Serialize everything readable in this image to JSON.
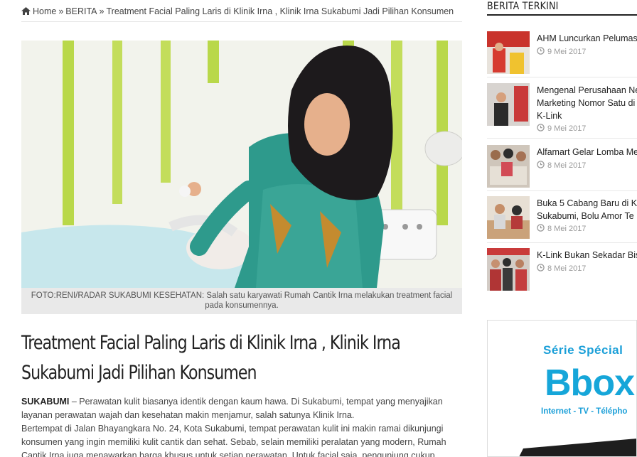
{
  "breadcrumb": {
    "home": "Home",
    "sep": "»",
    "section": "BERITA",
    "current": "Treatment Facial Paling Laris di Klinik Irna , Klinik Irna Sukabumi Jadi Pilihan Konsumen"
  },
  "article": {
    "photo_caption": "FOTO:RENI/RADAR SUKABUMI KESEHATAN: Salah satu karyawati Rumah Cantik Irna melakukan treatment facial pada konsumennya.",
    "title": "Treatment Facial Paling Laris di Klinik Irna , Klinik Irna Sukabumi Jadi Pilihan Konsumen",
    "dateline": "SUKABUMI",
    "paragraph1": " – Perawatan kulit biasanya identik dengan kaum hawa. Di Sukabumi, tempat yang menyajikan layanan perawatan wajah dan kesehatan makin menjamur, salah satunya Klinik Irna.",
    "paragraph2": "Bertempat di Jalan Bhayangkara No. 24, Kota Sukabumi, tempat perawatan kulit ini makin ramai dikunjungi konsumen yang ingin memiliki kulit cantik dan sehat. Sebab, selain memiliki peralatan yang modern, Rumah Cantik Irna juga menawarkan harga khusus untuk setiap perawatan. Untuk facial saja, pengunjung cukup"
  },
  "sidebar": {
    "heading": "BERITA TERKINI",
    "items": [
      {
        "title": "AHM Luncurkan Pelumas",
        "title2": "",
        "title3": "",
        "date": "9 Mei 2017"
      },
      {
        "title": "Mengenal Perusahaan Ne",
        "title2": "Marketing Nomor Satu di",
        "title3": "K-Link",
        "date": "9 Mei 2017"
      },
      {
        "title": "Alfamart Gelar Lomba Me",
        "title2": "",
        "title3": "",
        "date": "8 Mei 2017"
      },
      {
        "title": "Buka 5 Cabang Baru di K",
        "title2": "Sukabumi, Bolu Amor Te",
        "title3": "",
        "date": "8 Mei 2017"
      },
      {
        "title": "K-Link Bukan Sekadar Bis",
        "title2": "",
        "title3": "",
        "date": "8 Mei 2017"
      }
    ]
  },
  "ad": {
    "line1": "Série Spécial",
    "brand": "Bbox",
    "line3": "Internet - TV - Télépho"
  },
  "colors": {
    "accent": "#16a6d9",
    "date": "#999999",
    "caption_bg": "#e9e9e9"
  }
}
